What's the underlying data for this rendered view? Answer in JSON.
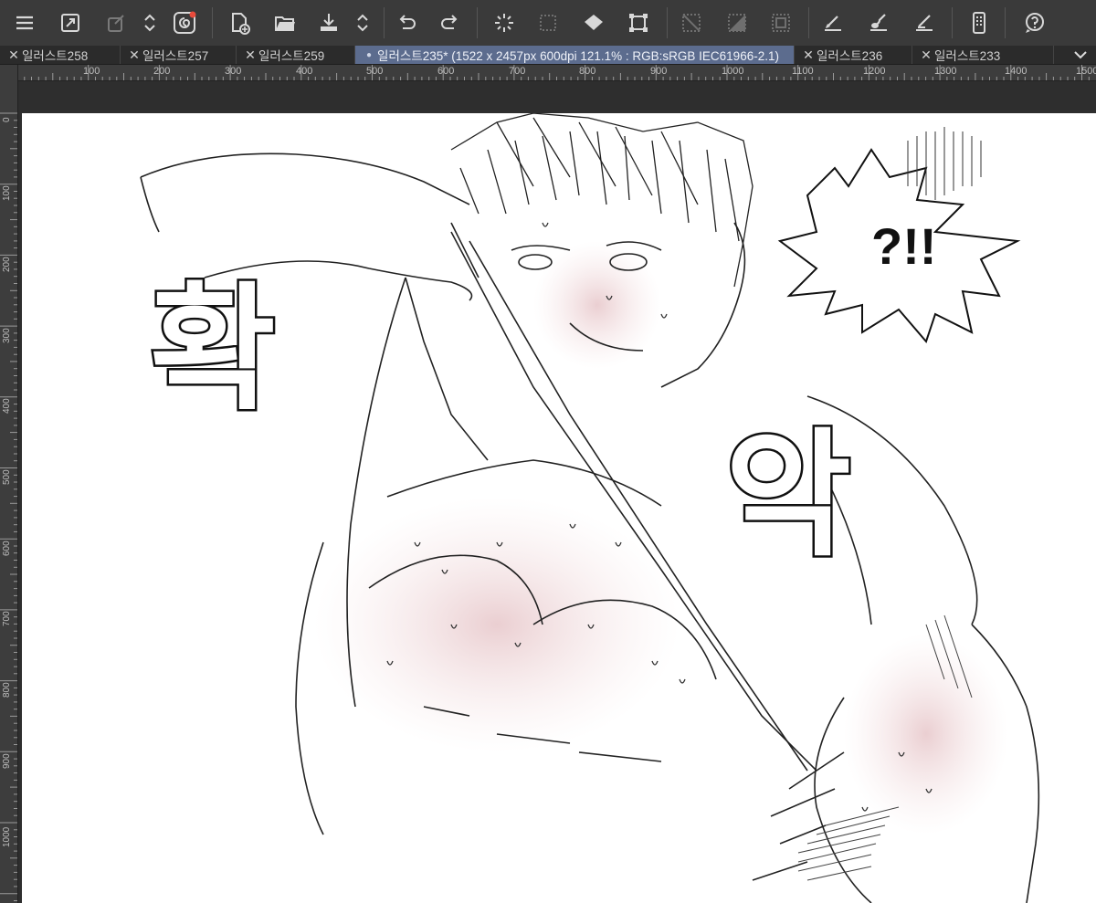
{
  "toolbar": {
    "buttons": [
      "menu-icon",
      "resize-icon",
      "transform-icon",
      "chevrons-icon",
      "spiral-icon",
      "new-file-icon",
      "open-folder-icon",
      "save-icon",
      "chevrons-icon",
      "undo-icon",
      "redo-icon",
      "selection-spinner-icon",
      "selection-dotted-icon",
      "fill-icon",
      "crop-icon",
      "deselect-icon",
      "invert-selection-icon",
      "select-all-icon",
      "pen-tool-icon",
      "brush-tool-icon",
      "eraser-tool-icon",
      "device-icon",
      "help-icon"
    ]
  },
  "tabs": [
    {
      "label": "일러스트258",
      "active": false
    },
    {
      "label": "일러스트257",
      "active": false
    },
    {
      "label": "일러스트259",
      "active": false
    },
    {
      "label": "일러스트235* (1522 x 2457px 600dpi 121.1% : RGB:sRGB IEC61966-2.1)",
      "active": true
    },
    {
      "label": "일러스트236",
      "active": false
    },
    {
      "label": "일러스트233",
      "active": false
    }
  ],
  "rulers": {
    "horizontal": [
      "100",
      "200",
      "300",
      "400",
      "500",
      "600",
      "700",
      "800",
      "900",
      "1000",
      "1100",
      "1200",
      "1300",
      "1400",
      "1500"
    ],
    "vertical": [
      "0",
      "100",
      "200",
      "300",
      "400",
      "500",
      "600",
      "700",
      "800",
      "900",
      "1000"
    ]
  },
  "artwork": {
    "sfx_left": "확",
    "sfx_right": "악",
    "speech_bubble": "?!!"
  },
  "colors": {
    "toolbar_bg": "#3a3a3a",
    "active_tab": "#5c6c8e",
    "paper": "#ffffff"
  }
}
